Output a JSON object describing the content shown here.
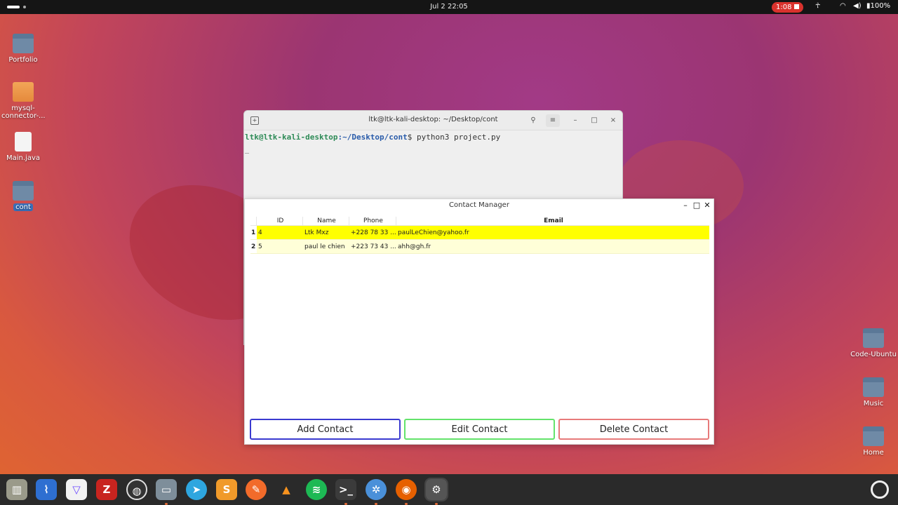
{
  "topbar": {
    "clock": "Jul 2  22:05",
    "recording_time": "1:08",
    "battery": "100%"
  },
  "desktop_icons": [
    {
      "label": "Portfolio",
      "type": "folder"
    },
    {
      "label": "mysql-connector-...",
      "type": "package"
    },
    {
      "label": "Main.java",
      "type": "java"
    },
    {
      "label": "cont",
      "type": "folder"
    },
    {
      "label": "Code-Ubuntu",
      "type": "folder"
    },
    {
      "label": "Music",
      "type": "folder"
    },
    {
      "label": "Home",
      "type": "folder"
    }
  ],
  "terminal": {
    "title": "ltk@ltk-kali-desktop: ~/Desktop/cont",
    "prompt_user": "ltk@ltk-kali-desktop",
    "prompt_path": ":~/Desktop/cont",
    "prompt_symbol": "$",
    "command": " python3 project.py",
    "cursor": "_"
  },
  "contact_manager": {
    "title": "Contact Manager",
    "columns": [
      "ID",
      "Name",
      "Phone",
      "Email"
    ],
    "rows": [
      {
        "index": "1",
        "id": "4",
        "name": "Ltk Mxz",
        "phone": "+228 78 33 ...",
        "email": "paulLeChien@yahoo.fr",
        "selected": true
      },
      {
        "index": "2",
        "id": "5",
        "name": "paul le chien",
        "phone": "+223 73 43 ...",
        "email": "ahh@gh.fr",
        "selected": false
      }
    ],
    "buttons": {
      "add": "Add Contact",
      "edit": "Edit Contact",
      "delete": "Delete Contact"
    },
    "colors": {
      "selected_row": "#ffff00",
      "row_bg": "#ffffd8",
      "add_border": "#3a3ad0",
      "edit_border": "#63e36b",
      "delete_border": "#e77a7a"
    }
  },
  "dock": {
    "apps": [
      "archive-manager-icon",
      "system-monitor-icon",
      "proton-vpn-icon",
      "filezilla-icon",
      "obs-studio-icon",
      "files-icon",
      "telegram-icon",
      "sublime-text-icon",
      "brush-icon",
      "vlc-icon",
      "spotify-icon",
      "terminal-icon",
      "kde-connect-icon",
      "firefox-icon",
      "settings-icon"
    ]
  }
}
